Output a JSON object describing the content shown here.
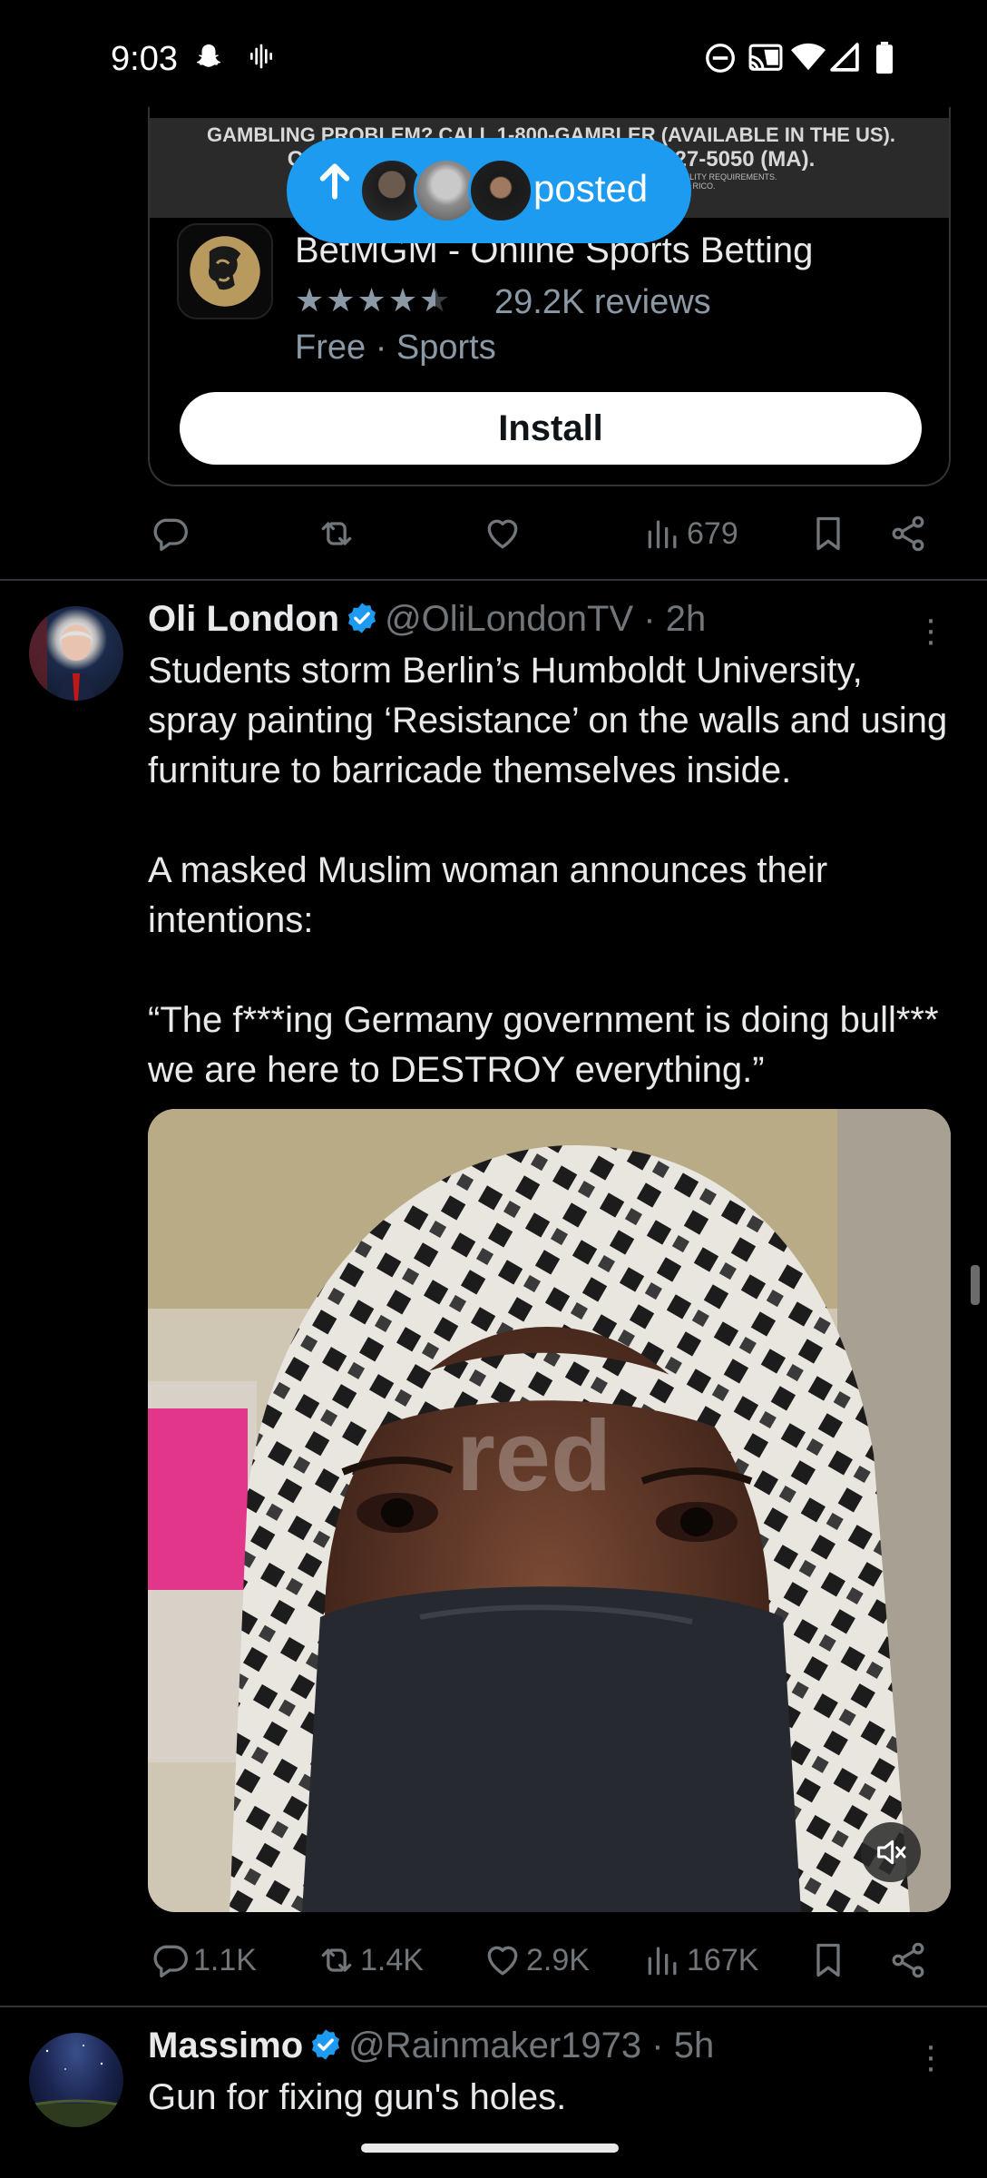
{
  "status_bar": {
    "time": "9:03",
    "icons": [
      "snapchat-icon",
      "voicemail-icon",
      "do-not-disturb-icon",
      "cast-icon",
      "wifi-icon",
      "signal-icon",
      "battery-icon"
    ]
  },
  "ad": {
    "banner_line1": "GAMBLING PROBLEM? CALL 1-800-GAMBLER (AVAILABLE IN THE US).",
    "banner_line2": "CALL 877-8-HOPENY ... CALL 1-800-327-5050 (MA).",
    "banner_line3": "21+ ONLY. PLEASE GAMBLE RESPONSIBLY. ... 1800GAMBLER.NET (WV). SUBJECT TO ELIGIBILITY REQUIREMENTS.",
    "banner_line4": "IN PARTNERSHIP WITH ... NOT AVAILABLE IN NEVADA, ONTARIO, OR PUERTO RICO.",
    "app_name": "BetMGM - Online Sports Betting",
    "rating": 4.5,
    "reviews": "29.2K reviews",
    "meta": "Free · Sports",
    "install_label": "Install",
    "views": "679"
  },
  "posted_pill": {
    "label": "posted"
  },
  "tweet1": {
    "name": "Oli London",
    "handle": "@OliLondonTV",
    "time": "· 2h",
    "paragraphs": [
      "Students storm Berlin’s Humboldt University, spray painting ‘Resistance’ on the walls and using furniture to barricade themselves inside.",
      "A masked Muslim woman announces their intentions:",
      "“The f***ing Germany government is doing bull*** we are here to DESTROY everything.”"
    ],
    "media_watermark": "red",
    "replies": "1.1K",
    "reposts": "1.4K",
    "likes": "2.9K",
    "views": "167K"
  },
  "tweet2": {
    "name": "Massimo",
    "handle": "@Rainmaker1973",
    "time": "· 5h",
    "text": "Gun for fixing gun's holes."
  },
  "colors": {
    "background": "#000000",
    "text": "#e7e9ea",
    "muted": "#71767b",
    "accent": "#1d9bf0",
    "divider": "#2f3336"
  }
}
